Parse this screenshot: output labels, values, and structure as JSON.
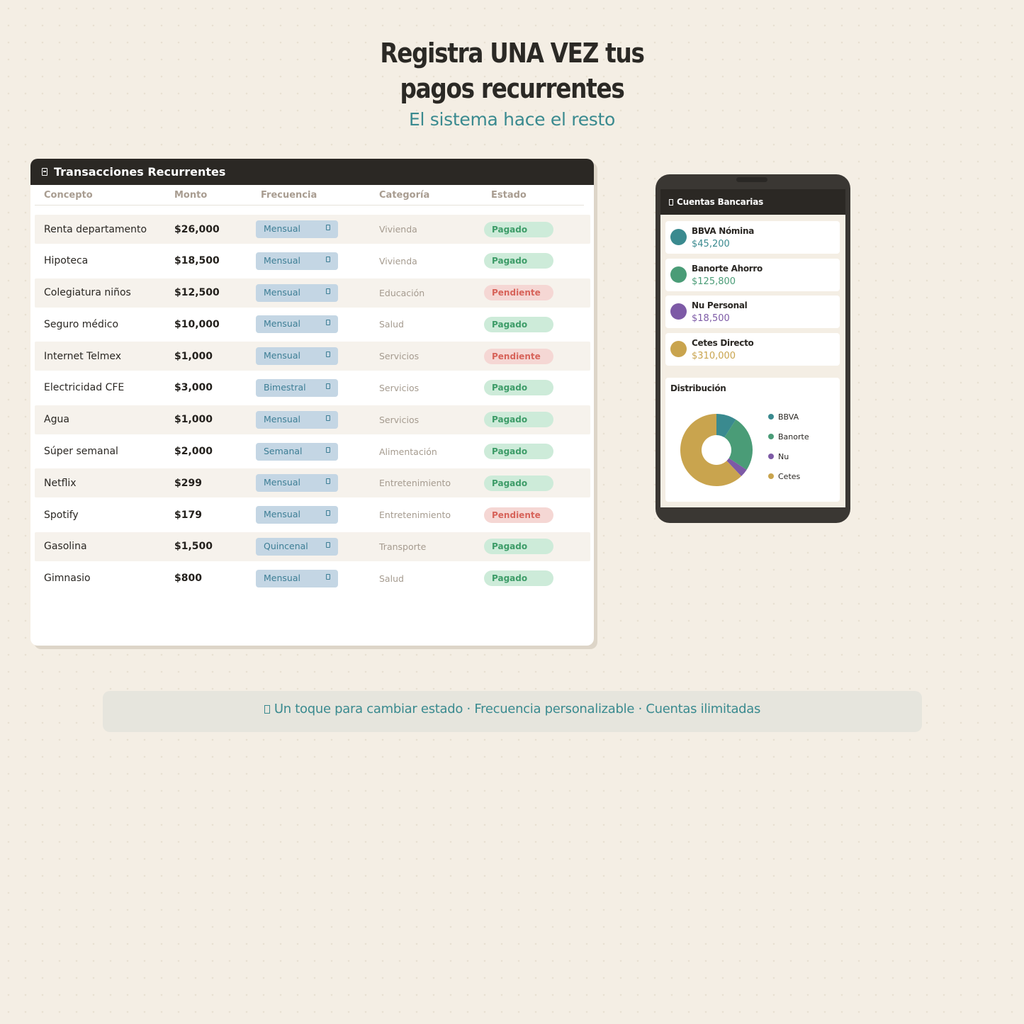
{
  "hero": {
    "title_line1": "Registra UNA VEZ tus",
    "title_line2": "pagos recurrentes",
    "subtitle": "El sistema hace el resto"
  },
  "transactions": {
    "title": "Transacciones Recurrentes",
    "columns": [
      "Concepto",
      "Monto",
      "Frecuencia",
      "Categoría",
      "Estado"
    ],
    "rows": [
      {
        "concept": "Renta departamento",
        "amount": "$26,000",
        "frequency": "Mensual",
        "category": "Vivienda",
        "status": "Pagado",
        "paid": true
      },
      {
        "concept": "Hipoteca",
        "amount": "$18,500",
        "frequency": "Mensual",
        "category": "Vivienda",
        "status": "Pagado",
        "paid": true
      },
      {
        "concept": "Colegiatura niños",
        "amount": "$12,500",
        "frequency": "Mensual",
        "category": "Educación",
        "status": "Pendiente",
        "paid": false
      },
      {
        "concept": "Seguro médico",
        "amount": "$10,000",
        "frequency": "Mensual",
        "category": "Salud",
        "status": "Pagado",
        "paid": true
      },
      {
        "concept": "Internet Telmex",
        "amount": "$1,000",
        "frequency": "Mensual",
        "category": "Servicios",
        "status": "Pendiente",
        "paid": false
      },
      {
        "concept": "Electricidad CFE",
        "amount": "$3,000",
        "frequency": "Bimestral",
        "category": "Servicios",
        "status": "Pagado",
        "paid": true
      },
      {
        "concept": "Agua",
        "amount": "$1,000",
        "frequency": "Mensual",
        "category": "Servicios",
        "status": "Pagado",
        "paid": true
      },
      {
        "concept": "Súper semanal",
        "amount": "$2,000",
        "frequency": "Semanal",
        "category": "Alimentación",
        "status": "Pagado",
        "paid": true
      },
      {
        "concept": "Netflix",
        "amount": "$299",
        "frequency": "Mensual",
        "category": "Entretenimiento",
        "status": "Pagado",
        "paid": true
      },
      {
        "concept": "Spotify",
        "amount": "$179",
        "frequency": "Mensual",
        "category": "Entretenimiento",
        "status": "Pendiente",
        "paid": false
      },
      {
        "concept": "Gasolina",
        "amount": "$1,500",
        "frequency": "Quincenal",
        "category": "Transporte",
        "status": "Pagado",
        "paid": true
      },
      {
        "concept": "Gimnasio",
        "amount": "$800",
        "frequency": "Mensual",
        "category": "Salud",
        "status": "Pagado",
        "paid": true
      }
    ]
  },
  "phone": {
    "header": "Cuentas Bancarias",
    "accounts": [
      {
        "name": "BBVA Nómina",
        "balance": "$45,200",
        "color": "#3a8a8f"
      },
      {
        "name": "Banorte Ahorro",
        "balance": "$125,800",
        "color": "#4a9c77"
      },
      {
        "name": "Nu Personal",
        "balance": "$18,500",
        "color": "#7d5aa6"
      },
      {
        "name": "Cetes Directo",
        "balance": "$310,000",
        "color": "#c9a44e"
      }
    ],
    "distribution_title": "Distribución",
    "chart_data": {
      "type": "pie",
      "categories": [
        "BBVA",
        "Banorte",
        "Nu",
        "Cetes"
      ],
      "values": [
        45200,
        125800,
        18500,
        310000
      ],
      "colors": [
        "#3a8a8f",
        "#4a9c77",
        "#7d5aa6",
        "#c9a44e"
      ],
      "donut": true,
      "legend_position": "right"
    }
  },
  "banner": {
    "text": "Un toque para cambiar estado · Frecuencia personalizable · Cuentas ilimitadas"
  },
  "colors": {
    "background": "#f4eee4",
    "accent_teal": "#3a8a8f",
    "dark_header": "#2b2824",
    "paid_bg": "#cdebd9",
    "paid_text": "#3d9c68",
    "pending_bg": "#f5d7d4",
    "pending_text": "#d7635a",
    "frequency_bg": "#c4d6e4"
  }
}
